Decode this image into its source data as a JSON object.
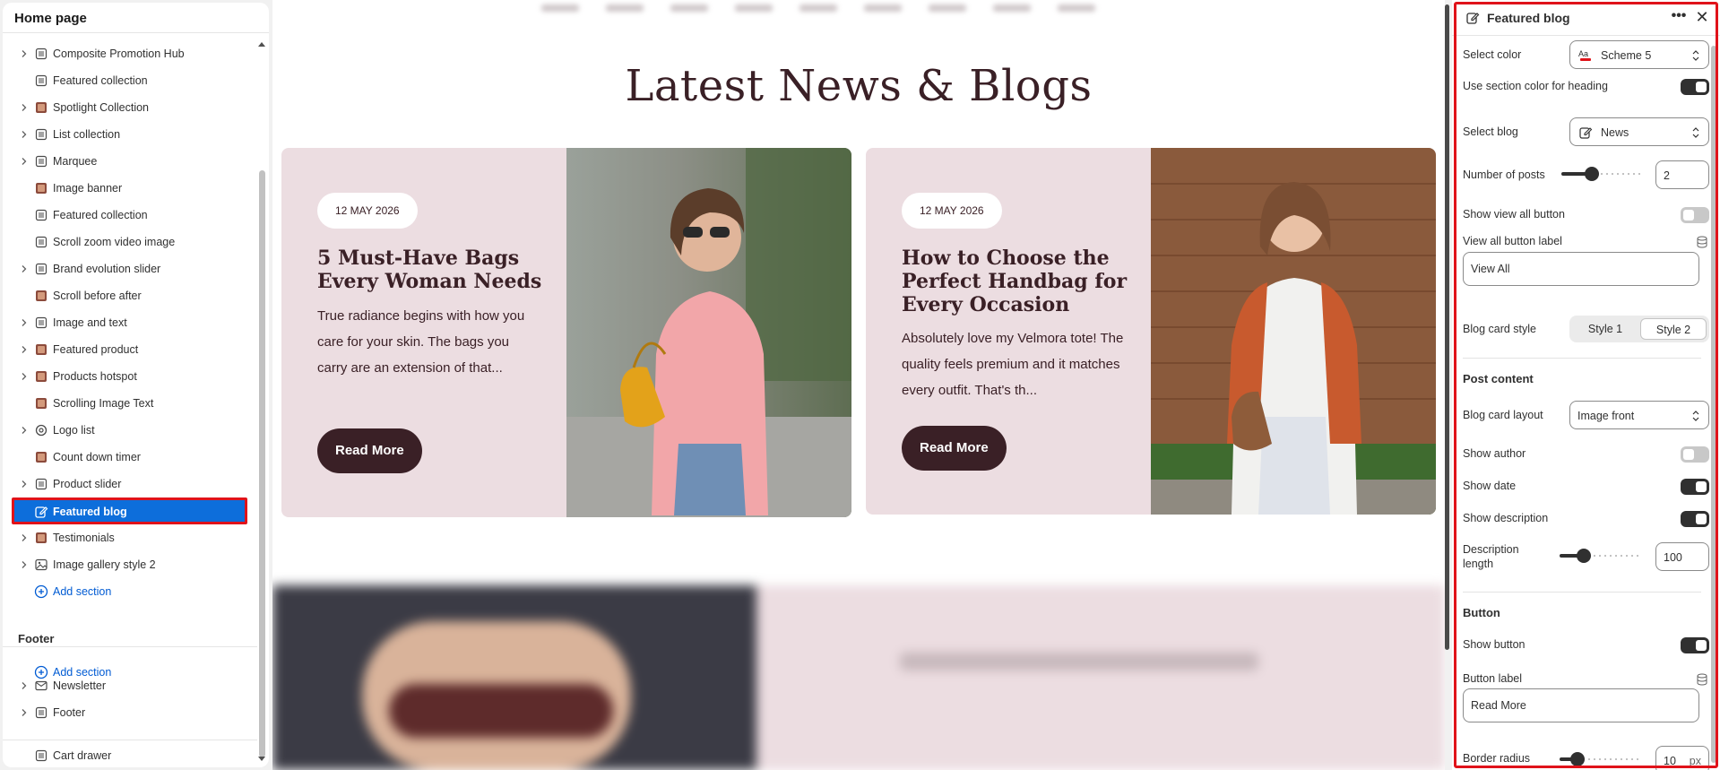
{
  "sidebar": {
    "title": "Home page",
    "sections": [
      {
        "label": "Composite Promotion Hub",
        "icon": "section-icon",
        "expandable": true
      },
      {
        "label": "Featured collection",
        "icon": "section-icon",
        "expandable": false
      },
      {
        "label": "Spotlight Collection",
        "icon": "thumbnail-icon",
        "expandable": true
      },
      {
        "label": "List collection",
        "icon": "section-icon",
        "expandable": true
      },
      {
        "label": "Marquee",
        "icon": "section-icon",
        "expandable": true
      },
      {
        "label": "Image banner",
        "icon": "thumbnail-icon",
        "expandable": false
      },
      {
        "label": "Featured collection",
        "icon": "section-icon",
        "expandable": false
      },
      {
        "label": "Scroll zoom video image",
        "icon": "section-icon",
        "expandable": false
      },
      {
        "label": "Brand evolution slider",
        "icon": "section-icon",
        "expandable": true
      },
      {
        "label": "Scroll before after",
        "icon": "thumbnail-icon",
        "expandable": false
      },
      {
        "label": "Image and text",
        "icon": "section-icon",
        "expandable": true
      },
      {
        "label": "Featured product",
        "icon": "thumbnail-icon",
        "expandable": true
      },
      {
        "label": "Products hotspot",
        "icon": "thumbnail-icon",
        "expandable": true
      },
      {
        "label": "Scrolling Image Text",
        "icon": "thumbnail-icon",
        "expandable": false
      },
      {
        "label": "Logo list",
        "icon": "gear-icon",
        "expandable": true
      },
      {
        "label": "Count down timer",
        "icon": "thumbnail-icon",
        "expandable": false
      },
      {
        "label": "Product slider",
        "icon": "section-icon",
        "expandable": true
      },
      {
        "label": "Featured blog",
        "icon": "edit-icon",
        "expandable": false,
        "selected": true
      },
      {
        "label": "Testimonials",
        "icon": "thumbnail-icon",
        "expandable": true
      },
      {
        "label": "Image gallery style 2",
        "icon": "image-icon",
        "expandable": true
      }
    ],
    "add_section": "Add section",
    "footer_title": "Footer",
    "footer_add_section": "Add section",
    "footer_items": [
      {
        "label": "Newsletter",
        "icon": "mail-icon",
        "expandable": true
      },
      {
        "label": "Footer",
        "icon": "section-icon",
        "expandable": true
      }
    ],
    "cart_drawer": "Cart drawer"
  },
  "preview": {
    "heading": "Latest News & Blogs",
    "cards": [
      {
        "date": "12 MAY 2026",
        "title": "5 Must-Have Bags Every Woman Needs",
        "description": "True radiance begins with how you care for your skin. The bags you carry are an extension of that...",
        "button": "Read More"
      },
      {
        "date": "12 MAY 2026",
        "title": "How to Choose the Perfect Handbag for Every Occasion",
        "description": "Absolutely love my Velmora tote! The quality feels premium and it matches every outfit. That's th...",
        "button": "Read More"
      }
    ]
  },
  "settings": {
    "title": "Featured blog",
    "select_color_label": "Select color",
    "select_color_value": "Scheme 5",
    "section_color_heading_label": "Use section color for heading",
    "section_color_heading_on": true,
    "select_blog_label": "Select blog",
    "select_blog_value": "News",
    "posts_label": "Number of posts",
    "posts_value": "2",
    "posts_slider_fraction": 0.35,
    "show_view_all_label": "Show view all button",
    "show_view_all_on": false,
    "view_all_label_label": "View all button label",
    "view_all_label_value": "View All",
    "card_style_label": "Blog card style",
    "card_style_options": [
      "Style 1",
      "Style 2"
    ],
    "card_style_selected": "Style 2",
    "post_content_title": "Post content",
    "card_layout_label": "Blog card layout",
    "card_layout_value": "Image front",
    "show_author_label": "Show author",
    "show_author_on": false,
    "show_date_label": "Show date",
    "show_date_on": true,
    "show_description_label": "Show description",
    "show_description_on": true,
    "description_length_label": "Description length",
    "description_length_value": "100",
    "description_slider_fraction": 0.25,
    "button_section_title": "Button",
    "show_button_label": "Show button",
    "show_button_on": true,
    "button_label_label": "Button label",
    "button_label_value": "Read More",
    "border_radius_label": "Border radius",
    "border_radius_value": "10",
    "border_radius_unit": "px"
  },
  "colors": {
    "accent_blue": "#0d6edb",
    "highlight_red": "#e0131a",
    "card_bg": "#ecdde1",
    "brand_dark": "#3a2026"
  }
}
